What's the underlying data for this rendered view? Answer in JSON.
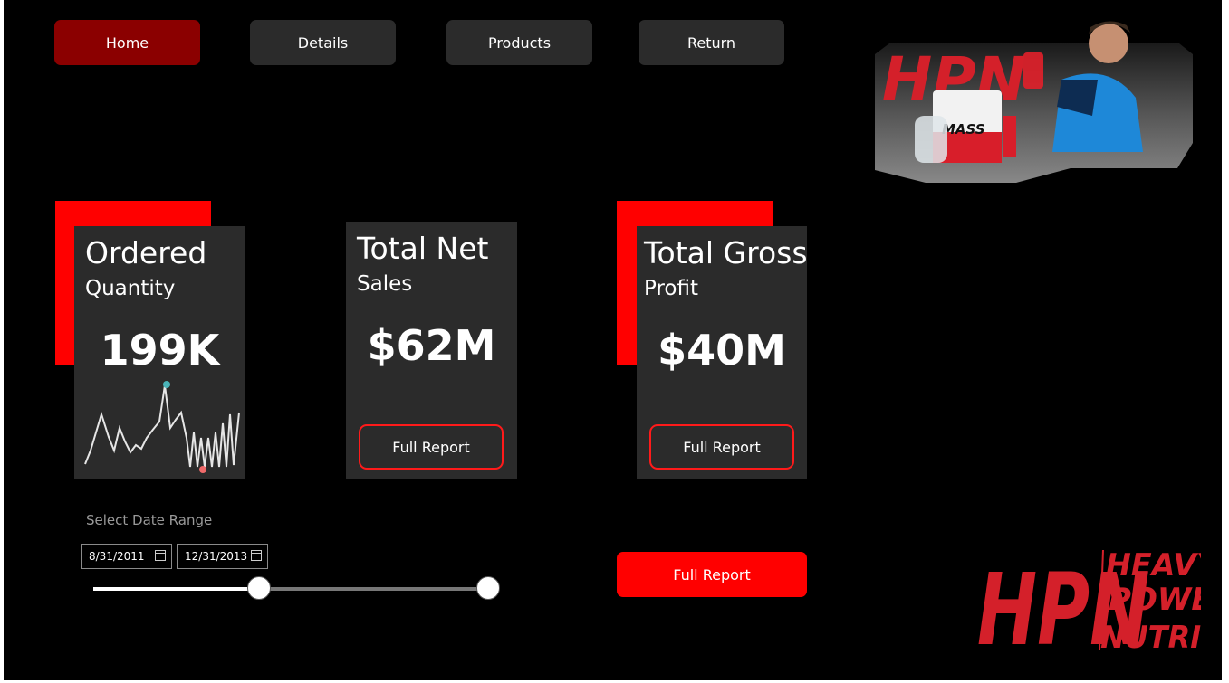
{
  "nav": {
    "items": [
      {
        "label": "Home",
        "active": true
      },
      {
        "label": "Details",
        "active": false
      },
      {
        "label": "Products",
        "active": false
      },
      {
        "label": "Return",
        "active": false
      }
    ]
  },
  "cards": [
    {
      "title": "Ordered",
      "subtitle": "Quantity",
      "value": "199K"
    },
    {
      "title": "Total Net",
      "subtitle": "Sales",
      "value": "$62M",
      "button": "Full Report"
    },
    {
      "title": "Total Gross",
      "subtitle": "Profit",
      "value": "$40M",
      "button": "Full Report"
    }
  ],
  "date_filter": {
    "label": "Select Date Range",
    "start": "8/31/2011",
    "end": "12/31/2013",
    "range_start_fraction": 0.42,
    "range_end_fraction": 1.0
  },
  "main_button": "Full Report",
  "brand": {
    "logo_text": "HPN",
    "tagline": [
      "HEAVY",
      "POWER",
      "NUTRITION"
    ],
    "product_label": "MASS"
  },
  "colors": {
    "accent": "#ff0000",
    "active_nav": "#8b0000",
    "card_bg": "#2b2b2b"
  }
}
